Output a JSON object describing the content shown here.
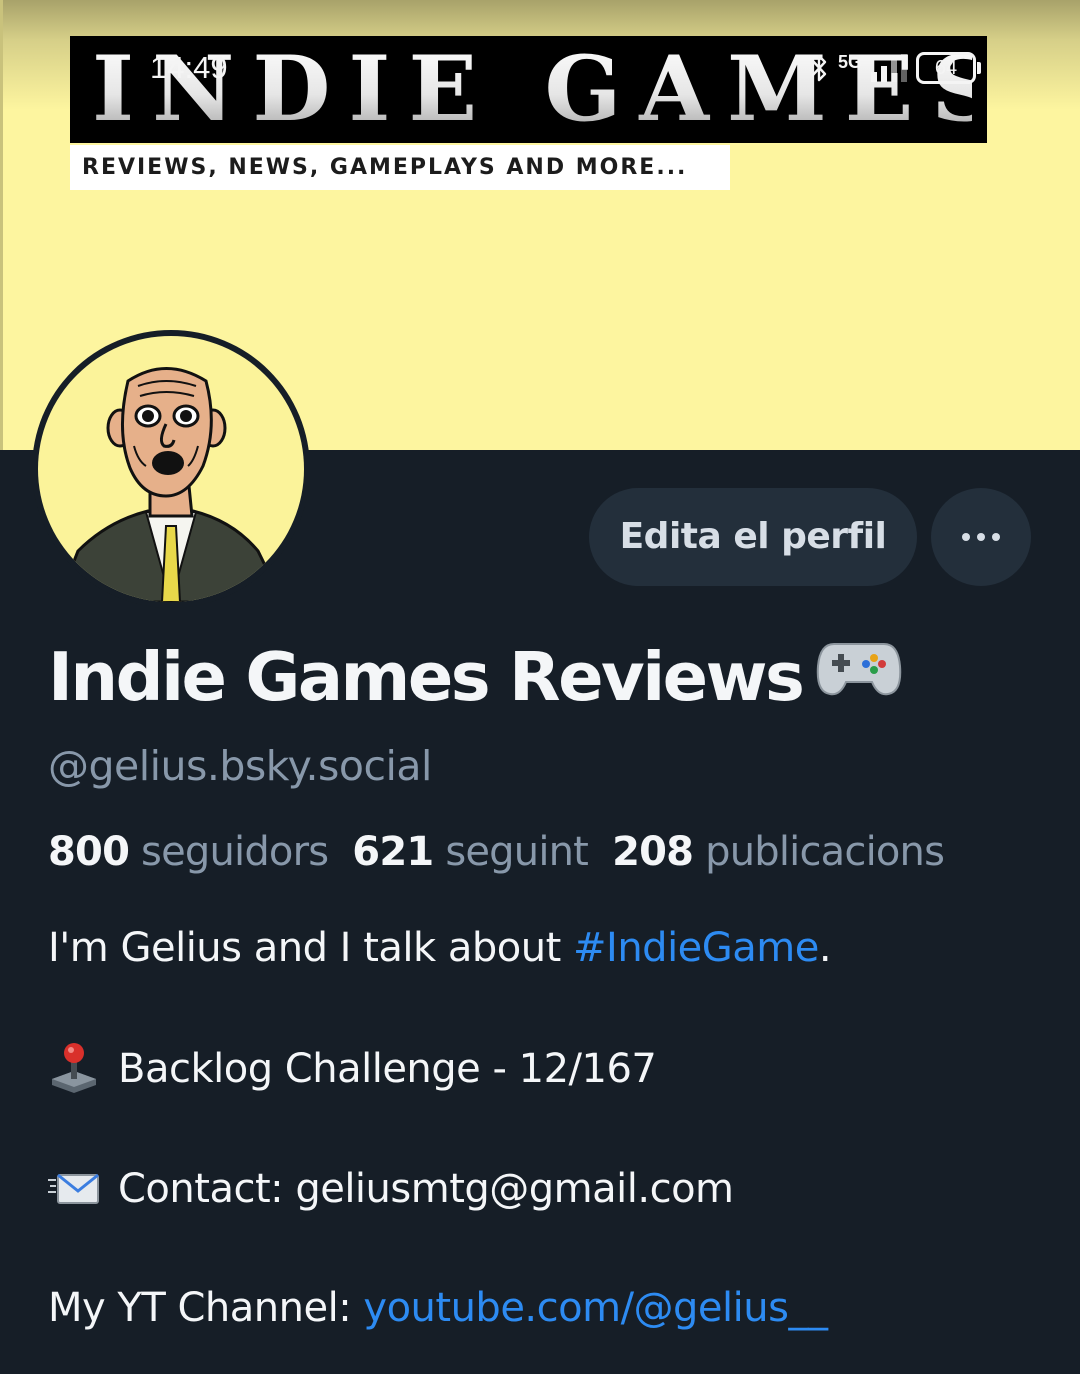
{
  "status_bar": {
    "time": "14:49",
    "network": "5G",
    "battery": "64",
    "icons": [
      "bluetooth-icon",
      "signal-icon",
      "battery-icon"
    ]
  },
  "banner": {
    "logo_title": "INDIE GAMES",
    "logo_tagline": "REVIEWS, NEWS, GAMEPLAYS AND MORE...",
    "background_color": "#fdf59f"
  },
  "actions": {
    "edit_profile_label": "Edita el perfil",
    "more_icon": "ellipsis-icon"
  },
  "profile": {
    "display_name": "Indie Games Reviews",
    "name_emoji_icon": "game-controller-icon",
    "handle": "@gelius.bsky.social"
  },
  "stats": [
    {
      "count": "800",
      "label": "seguidors"
    },
    {
      "count": "621",
      "label": "seguint"
    },
    {
      "count": "208",
      "label": "publicacions"
    }
  ],
  "bio": {
    "line1_text": "I'm Gelius and I talk about ",
    "line1_hashtag": "#IndieGame",
    "line1_end": ".",
    "line2_icon": "joystick-icon",
    "line2_text": "Backlog Challenge - 12/167",
    "line3_icon": "incoming-envelope-icon",
    "line3_text": "Contact: geliusmtg@gmail.com",
    "line4_text": "My YT Channel: ",
    "line4_link": "youtube.com/@gelius__"
  },
  "colors": {
    "background": "#161e27",
    "button_bg": "#232f3b",
    "link": "#2d8bf2",
    "muted_text": "#8898aa"
  }
}
